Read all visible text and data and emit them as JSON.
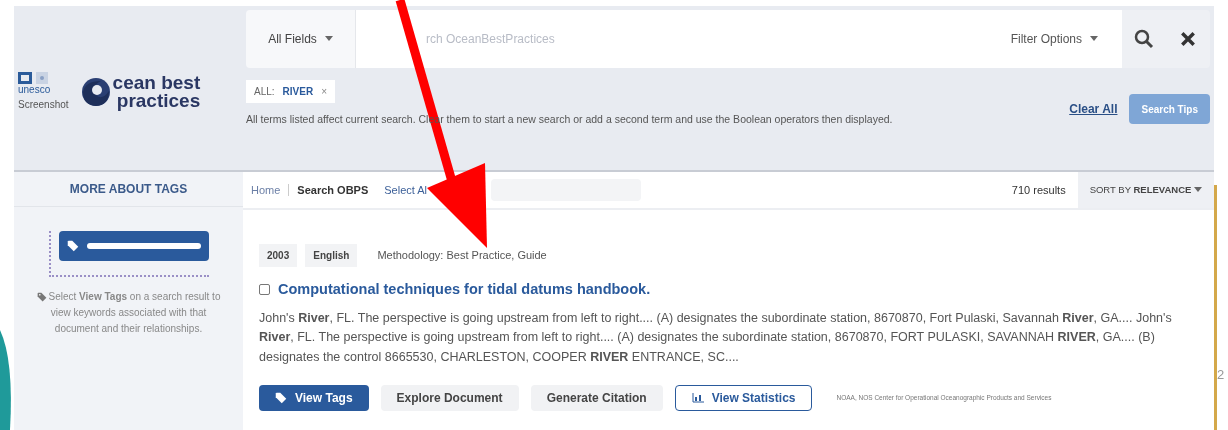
{
  "logo": {
    "partner": "unesco",
    "caption": "Screenshot",
    "line_1": "cean best",
    "line_2": "practices"
  },
  "search": {
    "field_selector": "All Fields",
    "placeholder": "rch OceanBestPractices",
    "filter": "Filter Options"
  },
  "active_terms": [
    {
      "field": "ALL:",
      "term": "RIVER",
      "remove": "×"
    }
  ],
  "terms_note": "All terms listed affect current search. Clear them to start a new search or add a second term and use the Boolean operators then displayed.",
  "clear_all": "Clear All",
  "search_tips": "Search Tips",
  "sidebar": {
    "title": "MORE ABOUT TAGS",
    "help": "Select **View Tags** on a search result to view keywords associated with that document and their relationships."
  },
  "breadcrumbs": [
    {
      "label": "Home",
      "selected": false
    },
    {
      "label": "Search OBPS",
      "selected": true
    }
  ],
  "select_all": "Select Al",
  "results_count": "710 results",
  "sort": {
    "prefix": "SORT BY",
    "value": "RELEVANCE"
  },
  "result": {
    "badges": [
      "2003",
      "English"
    ],
    "methodology": "Methodology: Best Practice, Guide",
    "checked": false,
    "title": "Computational techniques for tidal datums handbook.",
    "snippet": "John's **River**, FL. The perspective is going upstream from left to right.... (A) designates the subordinate station, 8670870, Fort Pulaski, Savannah **River**, GA.... John's **River**, FL. The perspective is going upstream from left to right.... (A) designates the subordinate station, 8670870, FORT PULASKI, SAVANNAH **RIVER**, GA.... (B) designates the control 8665530, CHARLESTON, COOPER **RIVER** ENTRANCE, SC....",
    "actions": [
      {
        "kind": "primary",
        "label": "View Tags"
      },
      {
        "kind": "plain",
        "label": "Explore Document"
      },
      {
        "kind": "plain",
        "label": "Generate Citation"
      },
      {
        "kind": "outline",
        "label": "View Statistics"
      }
    ],
    "source": "NOAA, NOS Center for Operational Oceanographic Products and Services"
  },
  "slide_number": "2"
}
